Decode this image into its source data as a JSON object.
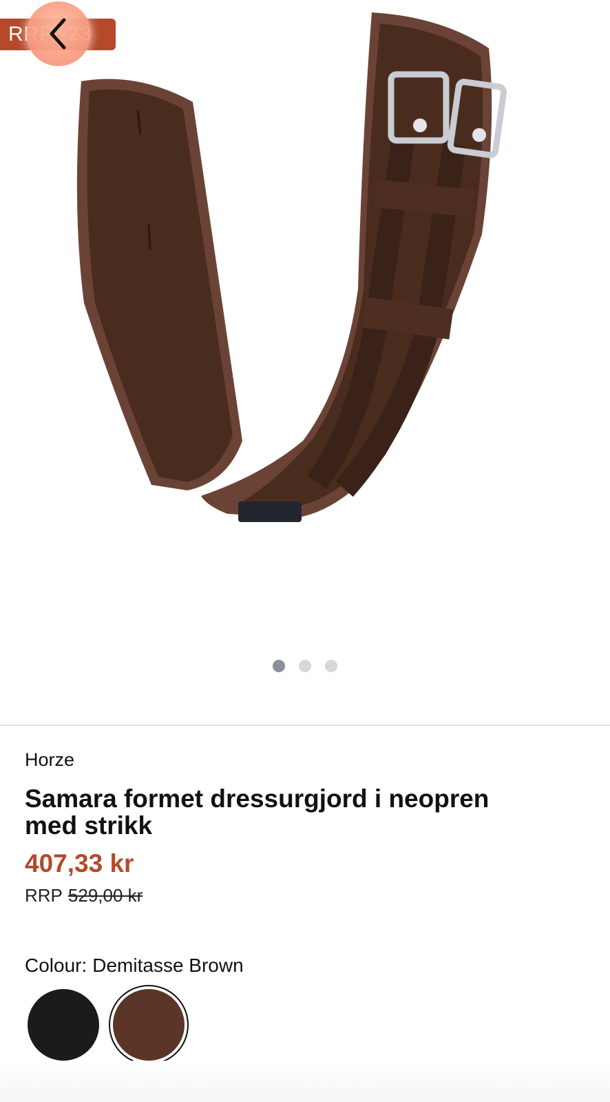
{
  "gallery": {
    "badge_text": "RRP -23 %",
    "image_alt": "Samara formet dressurgjord i neopren med strikk",
    "dots": [
      {
        "active": true
      },
      {
        "active": false
      },
      {
        "active": false
      }
    ],
    "back_icon": "chevron-left-icon"
  },
  "product": {
    "brand": "Horze",
    "title": "Samara formet dressurgjord i neopren med strikk",
    "price": "407,33 kr",
    "rrp_label": "RRP",
    "rrp_value": "529,00 kr"
  },
  "colour": {
    "label": "Colour:",
    "selected": "Demitasse Brown",
    "options": [
      {
        "name": "Black",
        "color": "#1b1b1b"
      },
      {
        "name": "Demitasse Brown",
        "color": "#5a3528"
      }
    ]
  },
  "colors": {
    "accent": "#b5492a",
    "back_button": "#f68c70",
    "dot_active": "#8c8f99",
    "dot_inactive": "#d6d8dd"
  }
}
